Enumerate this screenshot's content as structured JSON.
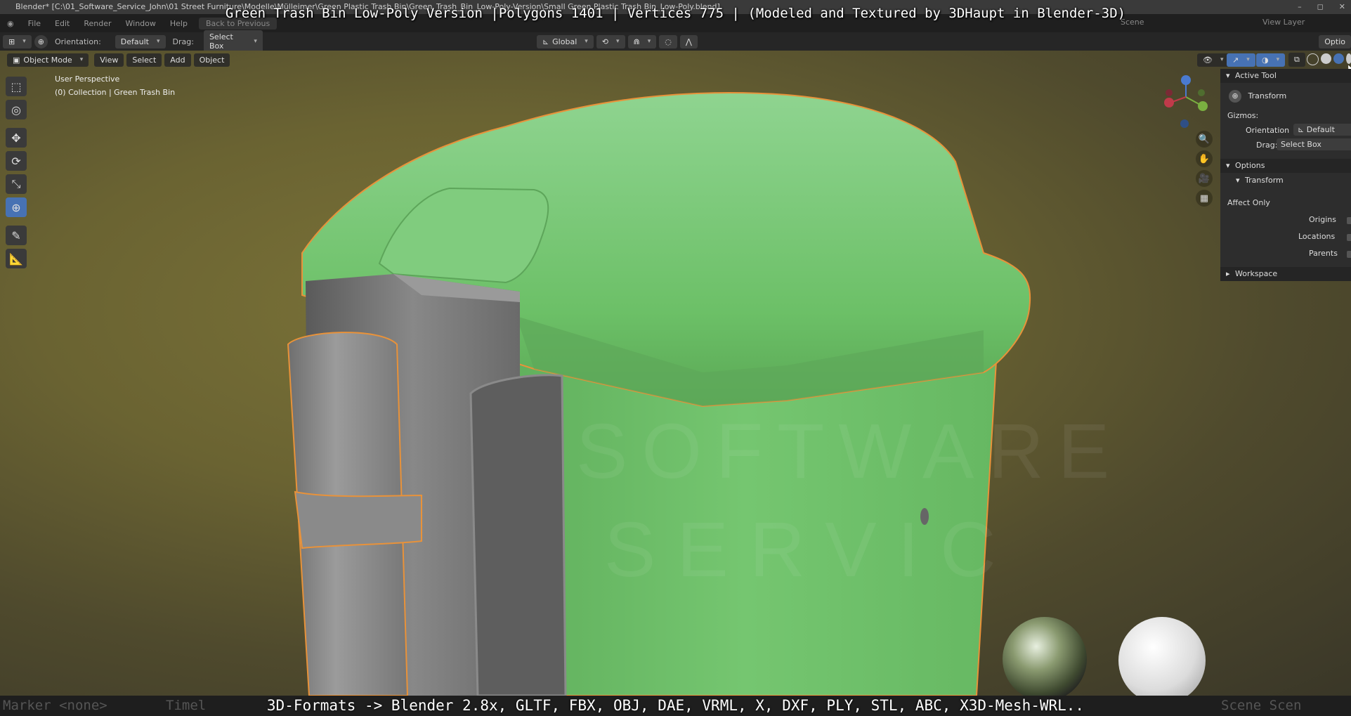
{
  "window": {
    "title": "Blender* [C:\\01_Software_Service_John\\01 Street Furniture\\Modelle\\Mülleimer\\Green Plastic Trash Bin\\Green_Trash_Bin_Low-Poly-Version\\Small Green Plastic Trash Bin_Low-Poly.blend]",
    "controls": [
      "–",
      "◻",
      "✕"
    ]
  },
  "overlay": {
    "top_caption": "Green Trash Bin Low-Poly Version |Polygons 1401 | Vertices 775 | (Modeled and Textured by 3DHaupt in Blender-3D)",
    "bottom_caption": "3D-Formats -> Blender 2.8x, GLTF, FBX, OBJ, DAE, VRML, X, DXF, PLY, STL, ABC, X3D-Mesh-WRL.."
  },
  "menubar": {
    "items": [
      "File",
      "Edit",
      "Render",
      "Window",
      "Help"
    ],
    "back_button": "Back to Previous",
    "scene_label": "Scene",
    "view_layer_label": "View Layer"
  },
  "header": {
    "orientation_label": "Orientation:",
    "orientation_value": "Default",
    "drag_label": "Drag:",
    "drag_value": "Select Box",
    "transform_space": "Global",
    "options_label": "Optio"
  },
  "viewport_header": {
    "mode": "Object Mode",
    "menus": [
      "View",
      "Select",
      "Add",
      "Object"
    ]
  },
  "viewport": {
    "perspective_text": "User Perspective",
    "collection_text": "(0) Collection | Green Trash Bin"
  },
  "tools": [
    {
      "name": "select-box-icon",
      "glyph": "⬚"
    },
    {
      "name": "cursor-icon",
      "glyph": "◎"
    },
    {
      "name": "move-icon",
      "glyph": "✥"
    },
    {
      "name": "rotate-icon",
      "glyph": "⟳"
    },
    {
      "name": "scale-icon",
      "glyph": "⤡"
    },
    {
      "name": "transform-icon",
      "glyph": "⊕"
    },
    {
      "name": "annotate-icon",
      "glyph": "✎"
    },
    {
      "name": "measure-icon",
      "glyph": "📐"
    }
  ],
  "npanel": {
    "active_tool_header": "Active Tool",
    "tool_name": "Transform",
    "gizmos_label": "Gizmos:",
    "orientation_label": "Orientation",
    "orientation_value": "Default",
    "drag_label": "Drag:",
    "drag_value": "Select Box",
    "options_header": "Options",
    "transform_sub": "Transform",
    "affect_only": "Affect Only",
    "origins": "Origins",
    "locations": "Locations",
    "parents": "Parents",
    "workspace_header": "Workspace"
  },
  "statusbar": {
    "marker_text": "Marker <none>",
    "timeline_text": "Timel",
    "scene_text": "Scene Scen"
  },
  "colors": {
    "bin_green": "#6fc06a",
    "accent_blue": "#4772b3",
    "selection_outline": "#e8923a"
  }
}
